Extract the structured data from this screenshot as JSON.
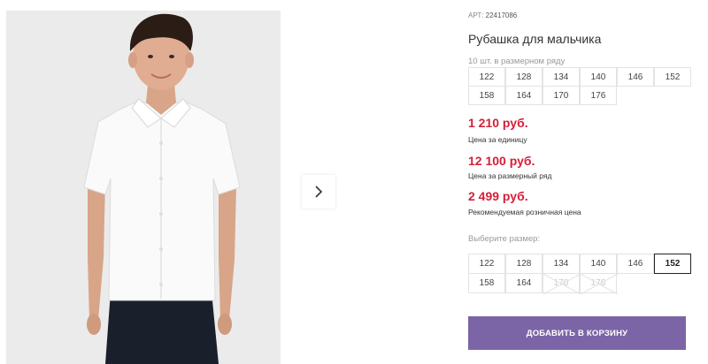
{
  "gallery": {
    "image_alt": "boy in white short-sleeve shirt",
    "next_icon": "chevron-right-icon"
  },
  "product": {
    "article_label": "АРТ:",
    "article_code": "22417086",
    "title": "Рубашка для мальчика"
  },
  "size_range": {
    "hint": "10 шт. в размерном ряду",
    "sizes": [
      "122",
      "128",
      "134",
      "140",
      "146",
      "152",
      "158",
      "164",
      "170",
      "176"
    ]
  },
  "prices": [
    {
      "value": "1 210 руб.",
      "label": "Цена за единицу"
    },
    {
      "value": "12 100 руб.",
      "label": "Цена за размерный ряд"
    },
    {
      "value": "2 499 руб.",
      "label": "Рекомендуемая розничная цена"
    }
  ],
  "size_select": {
    "label": "Выберите размер:",
    "sizes": [
      {
        "size": "122",
        "state": "available"
      },
      {
        "size": "128",
        "state": "available"
      },
      {
        "size": "134",
        "state": "available"
      },
      {
        "size": "140",
        "state": "available"
      },
      {
        "size": "146",
        "state": "available"
      },
      {
        "size": "152",
        "state": "selected"
      },
      {
        "size": "158",
        "state": "available"
      },
      {
        "size": "164",
        "state": "available"
      },
      {
        "size": "170",
        "state": "unavailable"
      },
      {
        "size": "176",
        "state": "unavailable"
      }
    ]
  },
  "cart_button": {
    "label": "ДОБАВИТЬ В КОРЗИНУ"
  },
  "colors": {
    "price": "#d51f38",
    "button": "#7b65a6",
    "photo_bg": "#ebebeb"
  }
}
